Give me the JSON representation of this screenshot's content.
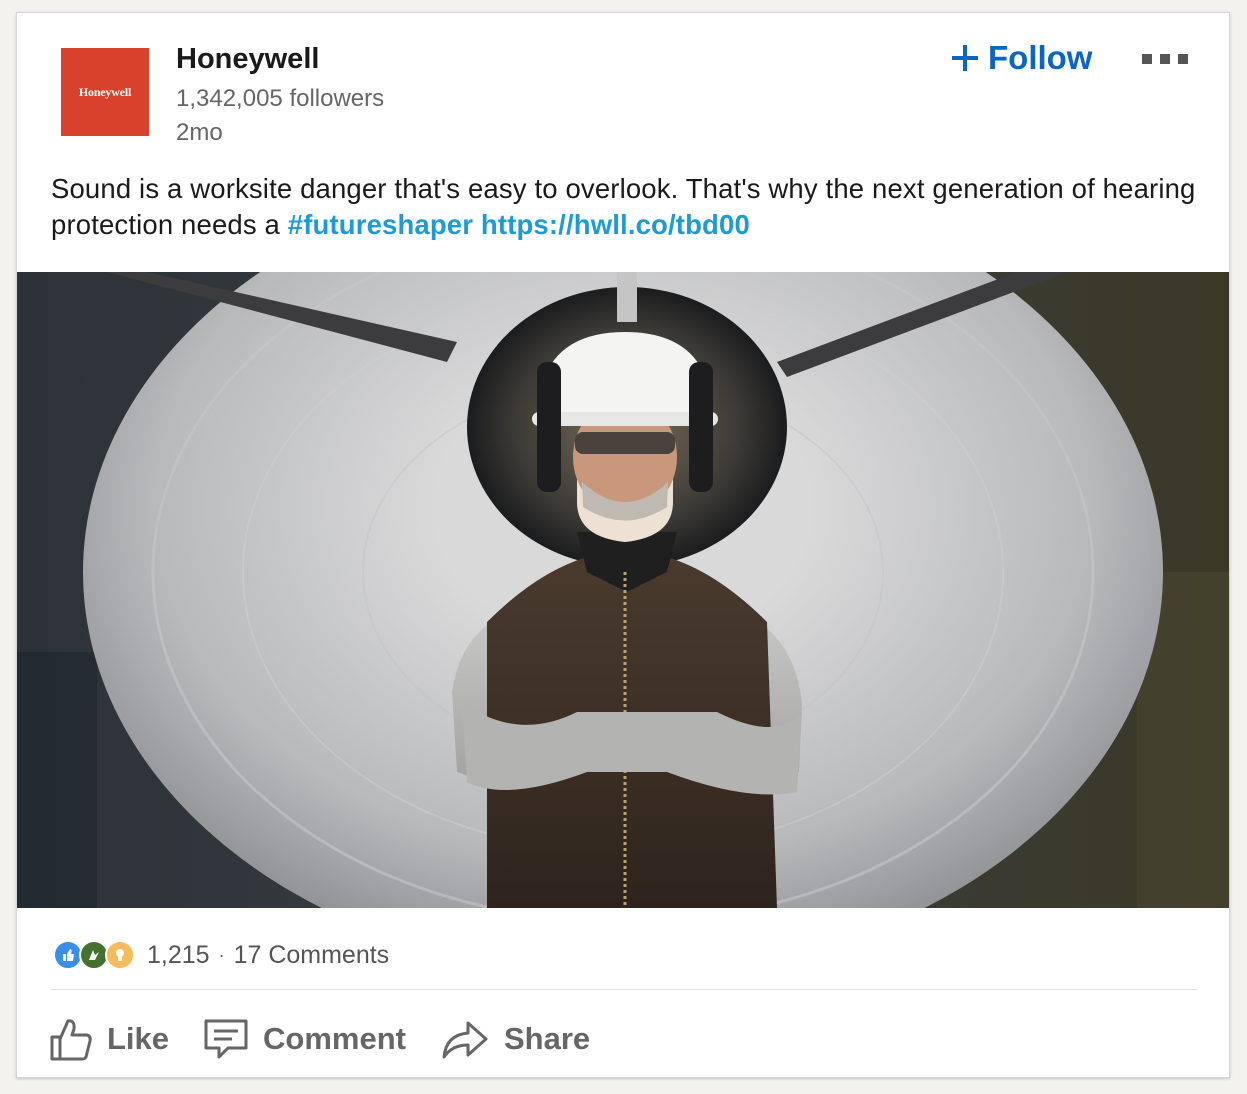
{
  "post": {
    "logo_text": "Honeywell",
    "company_name": "Honeywell",
    "followers": "1,342,005 followers",
    "timestamp": "2mo",
    "follow_label": "Follow",
    "text_main": "Sound is a worksite danger that's easy to overlook. That's why the next generation of hearing protection needs a ",
    "hashtag": "#futureshaper",
    "link": "https://hwll.co/tbd00",
    "reaction_count": "1,215",
    "separator": "·",
    "comments_count": "17 Comments"
  },
  "actions": {
    "like": "Like",
    "comment": "Comment",
    "share": "Share"
  },
  "reaction_icons": [
    "like-icon",
    "celebrate-icon",
    "insightful-icon"
  ],
  "colors": {
    "brand": "#d8412b",
    "link": "#1d9bd8",
    "follow": "#0a66c2"
  }
}
